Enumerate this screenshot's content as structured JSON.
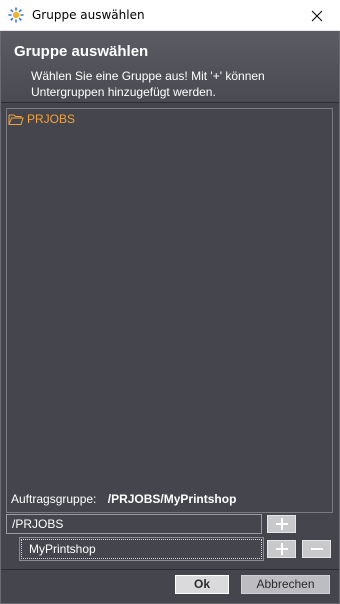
{
  "window": {
    "title": "Gruppe auswählen",
    "close_icon": "close-icon"
  },
  "header": {
    "title": "Gruppe auswählen",
    "description": "Wählen Sie eine Gruppe aus! Mit '+' können Untergruppen hinzugefügt werden."
  },
  "tree": {
    "items": [
      {
        "label": "PRJOBS",
        "icon": "folder-open-icon",
        "color": "#f3a13a"
      }
    ]
  },
  "group": {
    "label": "Auftragsgruppe:",
    "path": "/PRJOBS/MyPrintshop"
  },
  "fields": {
    "level1": "/PRJOBS",
    "level2": "MyPrintshop"
  },
  "buttons": {
    "ok": "Ok",
    "cancel": "Abbrechen"
  },
  "colors": {
    "background": "#45464d",
    "accent": "#f3a13a",
    "text": "#ffffff"
  }
}
